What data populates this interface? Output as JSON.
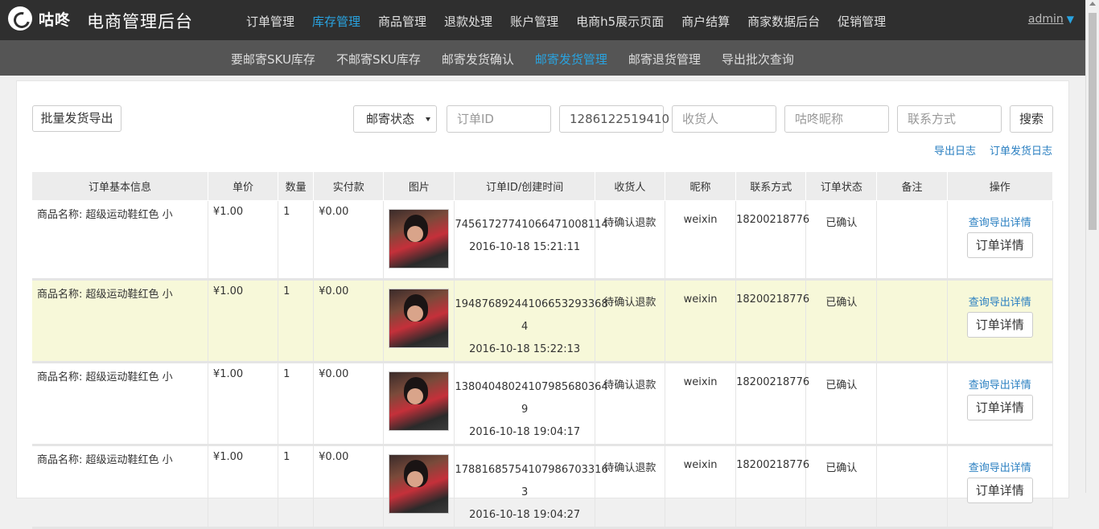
{
  "topbar": {
    "logo_text": "咕咚",
    "app_title": "电商管理后台",
    "nav": [
      "订单管理",
      "库存管理",
      "商品管理",
      "退款处理",
      "账户管理",
      "电商h5展示页面",
      "商户结算",
      "商家数据后台",
      "促销管理"
    ],
    "active_nav": "库存管理",
    "user": "admin",
    "accent_color": "#29a3e0"
  },
  "subnav": {
    "items": [
      "要邮寄SKU库存",
      "不邮寄SKU库存",
      "邮寄发货确认",
      "邮寄发货管理",
      "邮寄退货管理",
      "导出批次查询"
    ],
    "active": "邮寄发货管理"
  },
  "toolbar": {
    "export_button": "批量发货导出",
    "status_select": "邮寄状态",
    "order_id_placeholder": "订单ID",
    "order_id_value": "1286122519410",
    "receiver_placeholder": "收货人",
    "nickname_placeholder": "咕咚昵称",
    "contact_placeholder": "联系方式",
    "search_button": "搜索",
    "link_export_log": "导出日志",
    "link_ship_log": "订单发货日志"
  },
  "table": {
    "headers": [
      "订单基本信息",
      "单价",
      "数量",
      "实付款",
      "图片",
      "订单ID/创建时间",
      "收货人",
      "昵称",
      "联系方式",
      "订单状态",
      "备注",
      "操作"
    ],
    "rows": [
      {
        "info": "商品名称: 超级运动鞋红色 小",
        "price": "¥1.00",
        "qty": "1",
        "paid": "¥0.00",
        "order_id": "74561727741066471008114",
        "created": "2016-10-18 15:21:11",
        "receiver": "待确认退款",
        "nickname": "weixin",
        "contact": "18200218776",
        "status": "已确认",
        "note": "",
        "op_link": "查询导出详情",
        "op_button": "订单详情"
      },
      {
        "info": "商品名称: 超级运动鞋红色 小",
        "price": "¥1.00",
        "qty": "1",
        "paid": "¥0.00",
        "order_id": "19487689244106653293368​4",
        "created": "2016-10-18 15:22:13",
        "receiver": "待确认退款",
        "nickname": "weixin",
        "contact": "18200218776",
        "status": "已确认",
        "note": "",
        "op_link": "查询导出详情",
        "op_button": "订单详情"
      },
      {
        "info": "商品名称: 超级运动鞋红色 小",
        "price": "¥1.00",
        "qty": "1",
        "paid": "¥0.00",
        "order_id": "13804048024107985680364​9",
        "created": "2016-10-18 19:04:17",
        "receiver": "待确认退款",
        "nickname": "weixin",
        "contact": "18200218776",
        "status": "已确认",
        "note": "",
        "op_link": "查询导出详情",
        "op_button": "订单详情"
      },
      {
        "info": "商品名称: 超级运动鞋红色 小",
        "price": "¥1.00",
        "qty": "1",
        "paid": "¥0.00",
        "order_id": "17881685754107986703316​3",
        "created": "2016-10-18 19:04:27",
        "receiver": "待确认退款",
        "nickname": "weixin",
        "contact": "18200218776",
        "status": "已确认",
        "note": "",
        "op_link": "查询导出详情",
        "op_button": "订单详情"
      }
    ]
  }
}
